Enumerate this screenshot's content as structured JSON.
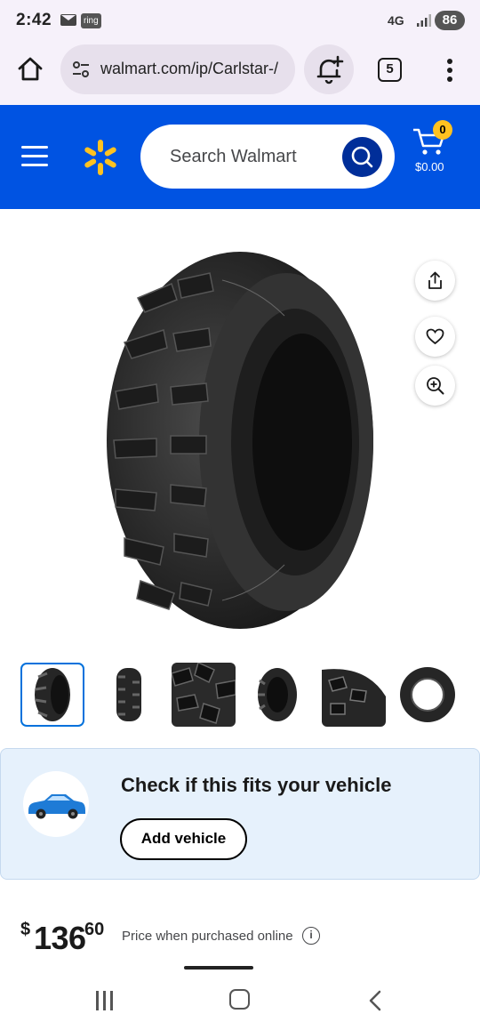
{
  "status_bar": {
    "time": "2:42",
    "ring_label": "ring",
    "network": "4G",
    "battery": "86"
  },
  "browser": {
    "url": "walmart.com/ip/Carlstar-/",
    "tab_count": "5"
  },
  "header": {
    "search_placeholder": "Search Walmart",
    "cart_count": "0",
    "cart_total": "$0.00",
    "brand_color": "#0053e2",
    "spark_color": "#ffc220"
  },
  "product": {
    "thumbnails": [
      "tire-angle",
      "tire-tread-front",
      "tire-tread-closeup",
      "tire-side-narrow",
      "tire-tread-detail",
      "tire-sidewall"
    ],
    "selected_thumbnail": 0
  },
  "fitment": {
    "title": "Check if this fits your vehicle",
    "button_label": "Add vehicle"
  },
  "price": {
    "currency": "$",
    "dollars": "136",
    "cents": "60",
    "note": "Price when purchased online",
    "info": "i"
  }
}
